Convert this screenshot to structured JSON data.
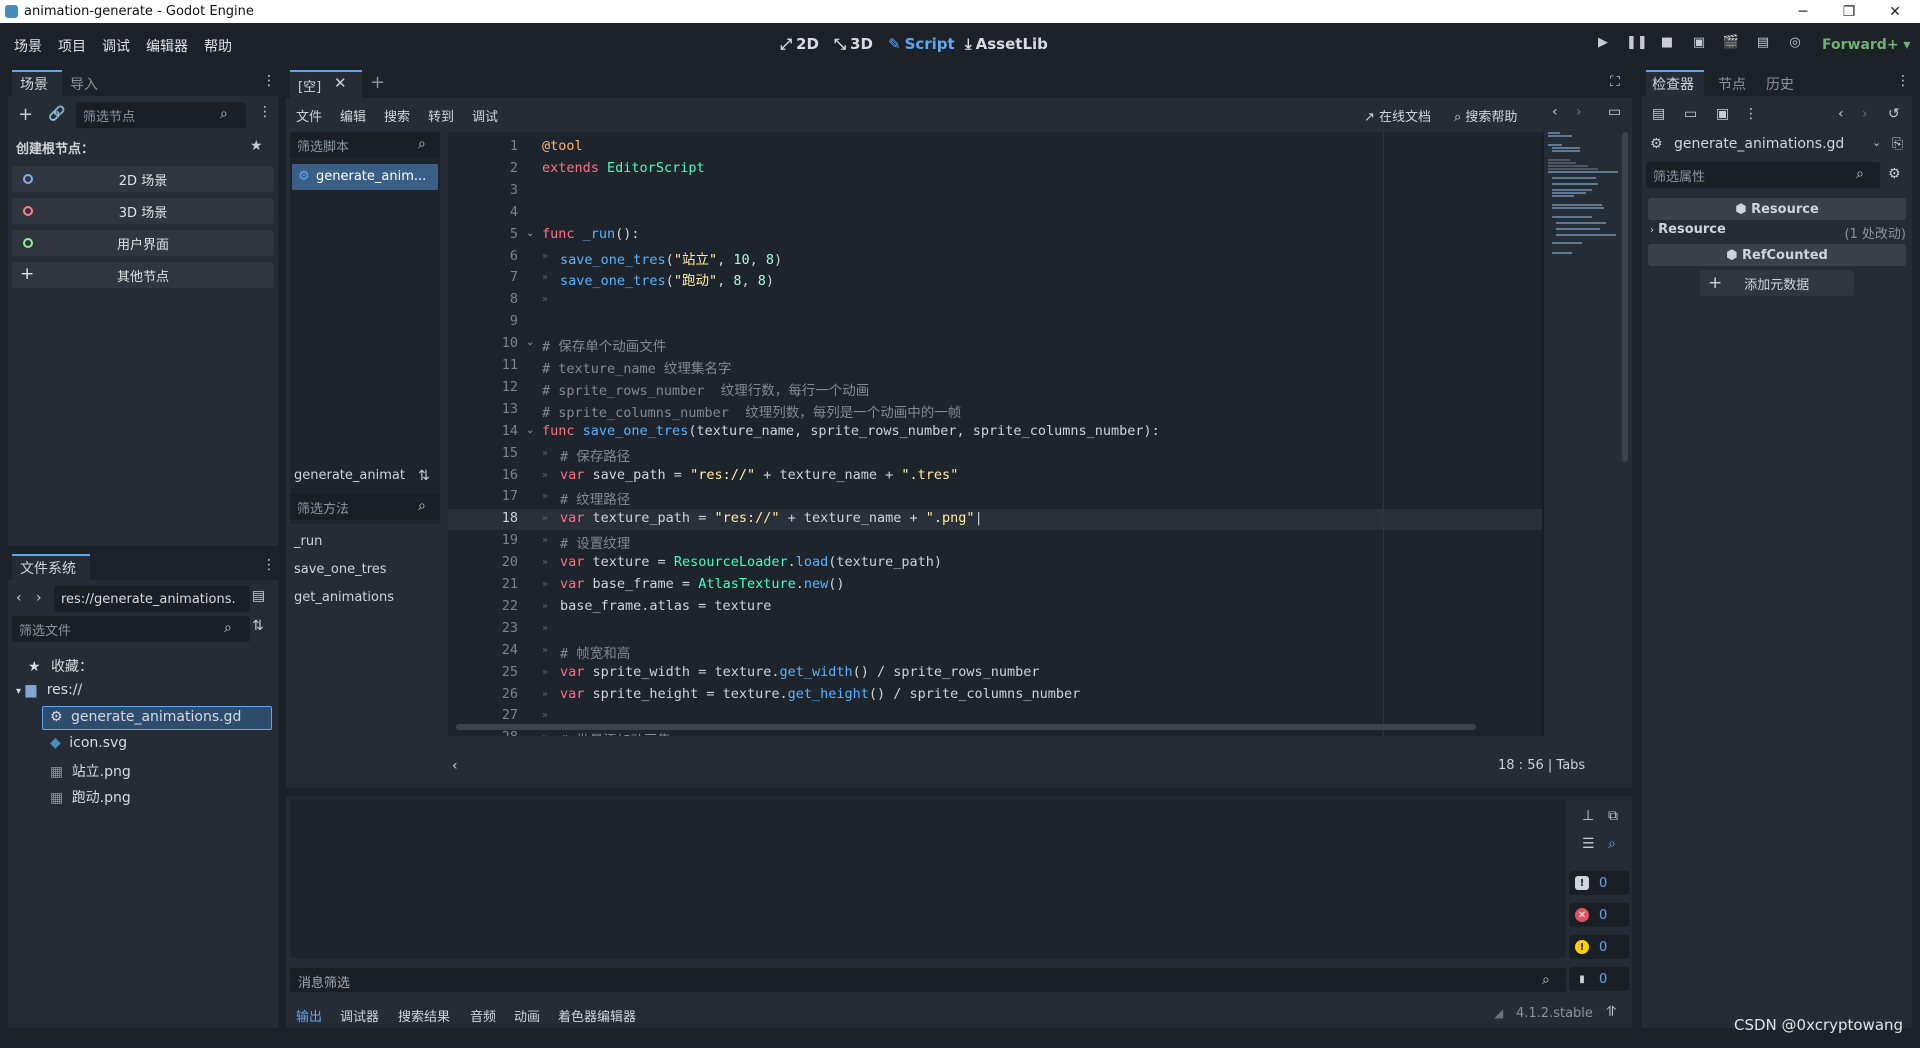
{
  "window": {
    "title": "animation-generate - Godot Engine",
    "minimize": "─",
    "maximize": "❐",
    "close": "✕"
  },
  "menu": [
    "场景",
    "项目",
    "调试",
    "编辑器",
    "帮助"
  ],
  "workspaces": [
    {
      "label": "2D",
      "icon": "2d-icon"
    },
    {
      "label": "3D",
      "icon": "3d-icon"
    },
    {
      "label": "Script",
      "icon": "script-icon"
    },
    {
      "label": "AssetLib",
      "icon": "assetlib-icon"
    }
  ],
  "renderer": "Forward+",
  "scene_dock": {
    "tabs": [
      "场景",
      "导入"
    ],
    "filter_placeholder": "筛选节点",
    "create_root_label": "创建根节点：",
    "root_buttons": [
      {
        "label": "2D 场景",
        "color": "#8da5f3"
      },
      {
        "label": "3D 场景",
        "color": "#fc7f7f"
      },
      {
        "label": "用户界面",
        "color": "#8eef97"
      },
      {
        "label": "其他节点",
        "color": ""
      }
    ]
  },
  "filesystem_dock": {
    "title": "文件系统",
    "path": "res://generate_animations.",
    "filter_placeholder": "筛选文件",
    "favorites": "收藏：",
    "root": "res://",
    "files": [
      "generate_animations.gd",
      "icon.svg",
      "站立.png",
      "跑动.png"
    ]
  },
  "script_editor": {
    "scene_tab": "[空]",
    "menu": [
      "文件",
      "编辑",
      "搜索",
      "转到",
      "调试"
    ],
    "online_docs": "在线文档",
    "search_help": "搜索帮助",
    "filter_scripts_placeholder": "筛选脚本",
    "open_script": "generate_anim...",
    "current_script_short": "generate_animat",
    "filter_methods_placeholder": "筛选方法",
    "methods": [
      "_run",
      "save_one_tres",
      "get_animations"
    ],
    "status": {
      "line": "18",
      "col": "56",
      "indent": "Tabs"
    }
  },
  "code_lines": [
    {
      "n": "1",
      "html": "<span class='at'>@tool</span>"
    },
    {
      "n": "2",
      "html": "<span class='k'>extends</span> <span class='t'>EditorScript</span>"
    },
    {
      "n": "3",
      "html": ""
    },
    {
      "n": "4",
      "html": ""
    },
    {
      "n": "5",
      "html": "<span class='k'>func</span> <span class='f'>_run</span><span class='p'>():</span>",
      "fold": true
    },
    {
      "n": "6",
      "html": "  <span class='f'>save_one_tres</span><span class='p'>(</span><span class='s'>\"站立\"</span><span class='p'>, </span><span class='n'>10</span><span class='p'>, </span><span class='n'>8</span><span class='p'>)</span>",
      "tab": true
    },
    {
      "n": "7",
      "html": "  <span class='f'>save_one_tres</span><span class='p'>(</span><span class='s'>\"跑动\"</span><span class='p'>, </span><span class='n'>8</span><span class='p'>, </span><span class='n'>8</span><span class='p'>)</span>",
      "tab": true
    },
    {
      "n": "8",
      "html": "",
      "tab": true
    },
    {
      "n": "9",
      "html": ""
    },
    {
      "n": "10",
      "html": "<span class='c'># 保存单个动画文件</span>",
      "fold": true
    },
    {
      "n": "11",
      "html": "<span class='c'># texture_name 纹理集名字</span>"
    },
    {
      "n": "12",
      "html": "<span class='c'># sprite_rows_number  纹理行数，每行一个动画</span>"
    },
    {
      "n": "13",
      "html": "<span class='c'># sprite_columns_number  纹理列数，每列是一个动画中的一帧</span>"
    },
    {
      "n": "14",
      "html": "<span class='k'>func</span> <span class='f'>save_one_tres</span><span class='p'>(texture_name, sprite_rows_number, sprite_columns_number):</span>",
      "fold": true
    },
    {
      "n": "15",
      "html": "  <span class='c'># 保存路径</span>",
      "tab": true
    },
    {
      "n": "16",
      "html": "  <span class='k'>var</span> <span class='p'>save_path = </span><span class='s'>\"res://\"</span><span class='p'> + texture_name + </span><span class='s'>\".tres\"</span>",
      "tab": true
    },
    {
      "n": "17",
      "html": "  <span class='c'># 纹理路径</span>",
      "tab": true
    },
    {
      "n": "18",
      "html": "  <span class='k'>var</span> <span class='p'>texture_path = </span><span class='s'>\"res://\"</span><span class='p'> + texture_name + </span><span class='s'>\".png\"</span><span class='p'>|</span>",
      "tab": true,
      "current": true
    },
    {
      "n": "19",
      "html": "  <span class='c'># 设置纹理</span>",
      "tab": true
    },
    {
      "n": "20",
      "html": "  <span class='k'>var</span> <span class='p'>texture = </span><span class='t'>ResourceLoader</span><span class='p'>.</span><span class='f'>load</span><span class='p'>(texture_path)</span>",
      "tab": true
    },
    {
      "n": "21",
      "html": "  <span class='k'>var</span> <span class='p'>base_frame = </span><span class='t'>AtlasTexture</span><span class='p'>.</span><span class='f'>new</span><span class='p'>()</span>",
      "tab": true
    },
    {
      "n": "22",
      "html": "  <span class='p'>base_frame.atlas = texture</span>",
      "tab": true
    },
    {
      "n": "23",
      "html": "",
      "tab": true
    },
    {
      "n": "24",
      "html": "  <span class='c'># 帧宽和高</span>",
      "tab": true
    },
    {
      "n": "25",
      "html": "  <span class='k'>var</span> <span class='p'>sprite_width = texture.</span><span class='f'>get_width</span><span class='p'>() / sprite_rows_number</span>",
      "tab": true
    },
    {
      "n": "26",
      "html": "  <span class='k'>var</span> <span class='p'>sprite_height = texture.</span><span class='f'>get_height</span><span class='p'>() / sprite_columns_number</span>",
      "tab": true
    },
    {
      "n": "27",
      "html": "",
      "tab": true
    },
    {
      "n": "28",
      "html": "  <span class='c'># 批量添加动画集</span>",
      "tab": true
    }
  ],
  "output_panel": {
    "filter_placeholder": "消息筛选",
    "counts": [
      "0",
      "0",
      "0",
      "0"
    ],
    "tabs": [
      "输出",
      "调试器",
      "搜索结果",
      "音频",
      "动画",
      "着色器编辑器"
    ],
    "version": "4.1.2.stable"
  },
  "inspector": {
    "tabs": [
      "检查器",
      "节点",
      "历史"
    ],
    "object": "generate_animations.gd",
    "filter_placeholder": "筛选属性",
    "resource_header": "Resource",
    "resource_row": "Resource",
    "resource_changes": "(1 处改动)",
    "refcounted_header": "RefCounted",
    "add_metadata": "添加元数据"
  },
  "watermark": "CSDN @0xcryptowang",
  "colors": {
    "accent": "#5fa7f0",
    "keyword": "#ff7085",
    "function": "#57b3ff",
    "string": "#ffeda1",
    "type": "#42ffc2"
  }
}
